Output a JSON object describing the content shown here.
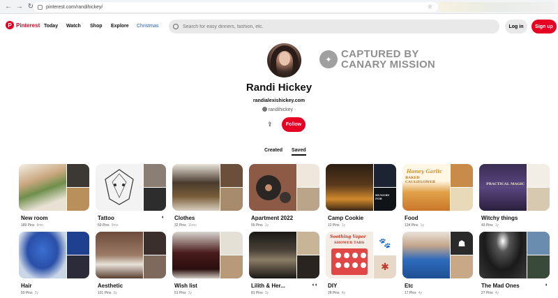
{
  "browser": {
    "url": "pinterest.com/randihickey/",
    "back_icon": "arrow-left-icon",
    "forward_icon": "arrow-right-icon",
    "reload_icon": "reload-icon"
  },
  "header": {
    "logo_text": "Pinterest",
    "nav": [
      "Today",
      "Watch",
      "Shop",
      "Explore",
      "Christmas"
    ],
    "search_placeholder": "Search for easy dinners, fashion, etc.",
    "login_label": "Log in",
    "signup_label": "Sign up",
    "brand_color": "#e60023"
  },
  "profile": {
    "name": "Randi Hickey",
    "website": "randialexishickey.com",
    "handle": "randihickey",
    "handle_suffix": "·",
    "follow_label": "Follow"
  },
  "watermark": {
    "line1": "CAPTURED BY",
    "line2": "CANARY MISSION"
  },
  "tabs": [
    "Created",
    "Saved"
  ],
  "active_tab": "Saved",
  "boards": [
    {
      "title": "New room",
      "pins": "189 Pins",
      "age": "8mo"
    },
    {
      "title": "Tattoo",
      "pins": "59 Pins",
      "age": "9mo"
    },
    {
      "title": "Clothes",
      "pins": "32 Pins",
      "age": "11mo"
    },
    {
      "title": "Apartment 2022",
      "pins": "55 Pins",
      "age": "1y"
    },
    {
      "title": "Camp Cookie",
      "pins": "12 Pins",
      "age": "1y"
    },
    {
      "title": "Food",
      "pins": "134 Pins",
      "age": "1y"
    },
    {
      "title": "Witchy things",
      "pins": "43 Pins",
      "age": "1y"
    },
    {
      "title": "Hair",
      "pins": "50 Pins",
      "age": "2y"
    },
    {
      "title": "Aesthetic",
      "pins": "101 Pins",
      "age": "2y"
    },
    {
      "title": "Wish list",
      "pins": "51 Pins",
      "age": "2y"
    },
    {
      "title": "Lilith & Her...",
      "pins": "81 Pins",
      "age": "3y"
    },
    {
      "title": "DIY",
      "pins": "28 Pins",
      "age": "4y"
    },
    {
      "title": "Etc",
      "pins": "17 Pins",
      "age": "4y"
    },
    {
      "title": "The Mad Ones",
      "pins": "27 Pins",
      "age": "4y"
    }
  ],
  "board_text": {
    "food_line1": "Honey Garlic",
    "food_line2": "BAKED CAULIFLOWER",
    "diy_line1": "Soothing Vapor",
    "diy_line2": "SHOWER TABS",
    "witchy_text": "PRACTICAL MAGIC",
    "camp_text": "HUNGRY FOR"
  }
}
